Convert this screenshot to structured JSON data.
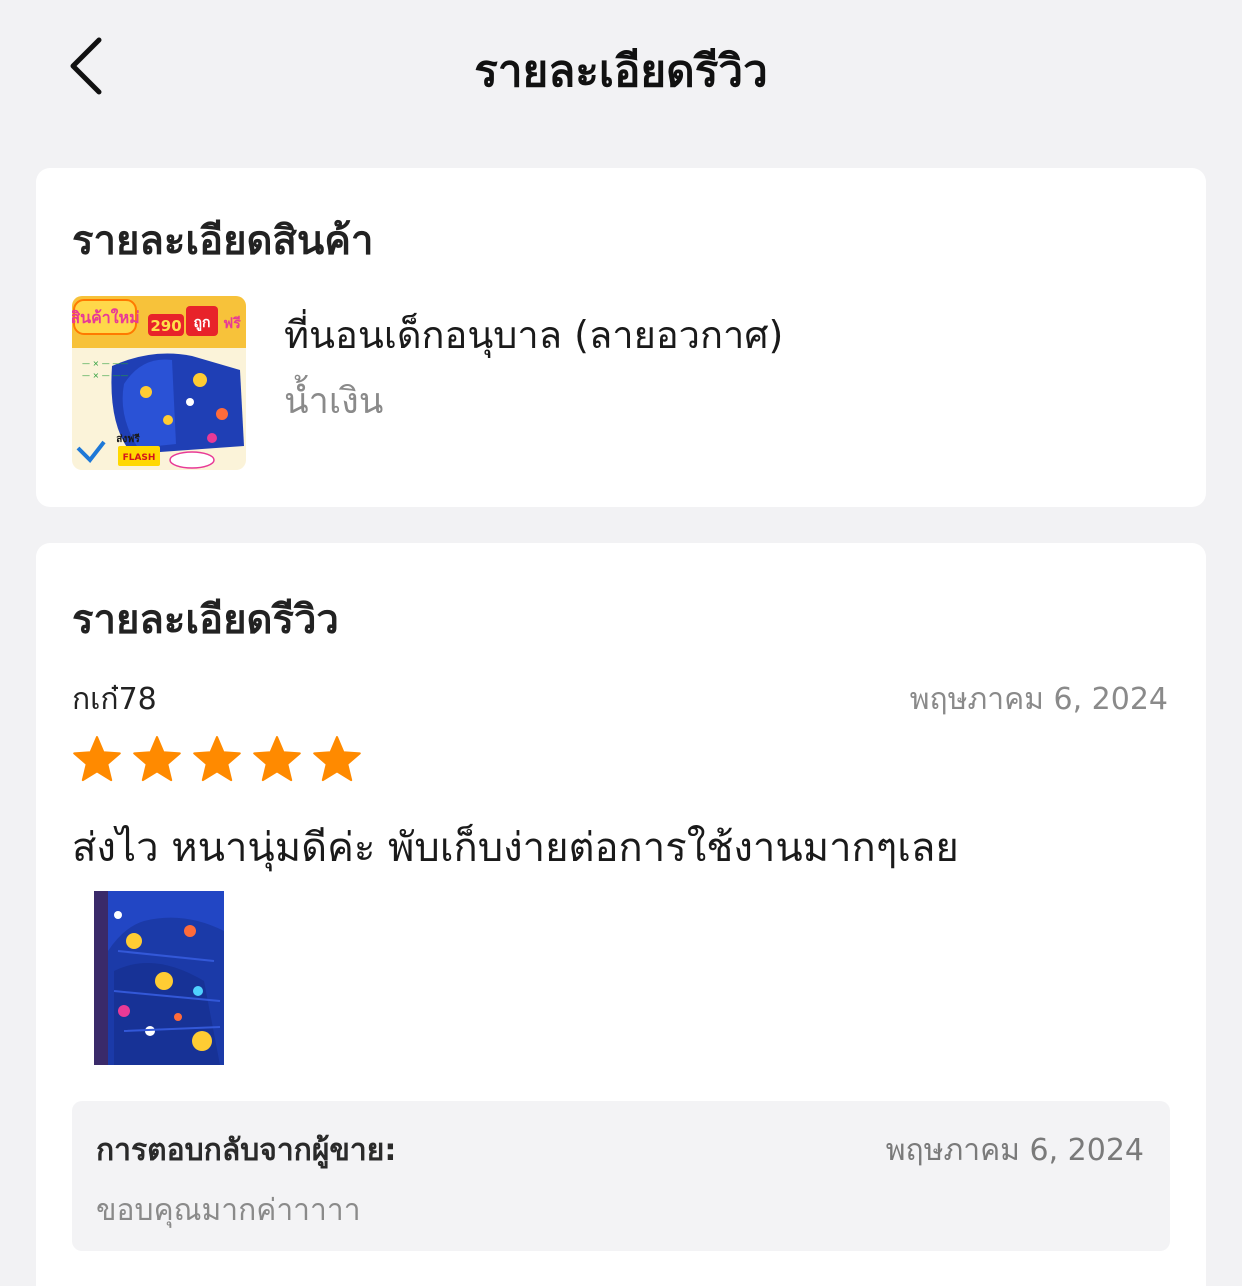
{
  "header": {
    "title": "รายละเอียดรีวิว",
    "back_icon": "chevron-left-icon"
  },
  "product_section": {
    "title": "รายละเอียดสินค้า",
    "product_name": "ที่นอนเด็กอนุบาล (ลายอวกาศ)",
    "variant": "น้ำเงิน",
    "thumb": {
      "badge_new": "สินค้าใหม่",
      "price": "290",
      "badge_cheap": "ถูก",
      "badge_free": "ฟรี",
      "shipping": "ส่งฟรี",
      "courier": "FLASH"
    }
  },
  "review_section": {
    "title": "รายละเอียดรีวิว",
    "reviewer": "กเก๋78",
    "date": "พฤษภาคม 6, 2024",
    "rating": 5,
    "rating_max": 5,
    "star_color": "#ff8a00",
    "text": "ส่งไว หนานุ่มดีค่ะ พับเก็บง่ายต่อการใช้งานมากๆเลย",
    "photo_count": 1
  },
  "seller_reply": {
    "label": "การตอบกลับจากผู้ขาย:",
    "date": "พฤษภาคม 6, 2024",
    "text": "ขอบคุณมากค่าาาาา"
  },
  "colors": {
    "background": "#f2f2f4",
    "card": "#ffffff",
    "muted_text": "#8a8a8a",
    "star": "#ff8a00"
  }
}
